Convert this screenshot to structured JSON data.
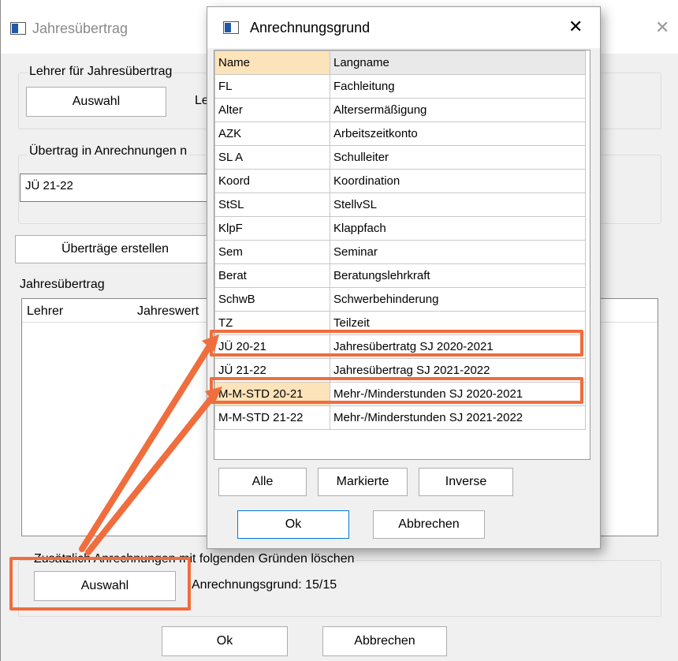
{
  "main": {
    "title": "Jahresübertrag",
    "teacher_group_label": "Lehrer für Jahresübertrag",
    "select_button": "Auswahl",
    "teacher_text": "Le",
    "transfer_group_label": "Übertrag in Anrechnungen n",
    "transfer_value": "JÜ 21-22",
    "create_button": "Überträge erstellen",
    "list_label": "Jahresübertrag",
    "list_columns": [
      "Lehrer",
      "Jahreswert"
    ],
    "delete_group_label": "Zusätzlich Anrechnungen mit folgenden Gründen löschen",
    "delete_select_button": "Auswahl",
    "reason_count": "Anrechnungsgrund: 15/15",
    "ok_button": "Ok",
    "cancel_button": "Abbrechen"
  },
  "dialog": {
    "title": "Anrechnungsgrund",
    "columns": [
      "Name",
      "Langname"
    ],
    "rows": [
      {
        "name": "FL",
        "long": "Fachleitung"
      },
      {
        "name": "Alter",
        "long": "Altersermäßigung"
      },
      {
        "name": "AZK",
        "long": "Arbeitszeitkonto"
      },
      {
        "name": "SL A",
        "long": "Schulleiter"
      },
      {
        "name": "Koord",
        "long": "Koordination"
      },
      {
        "name": "StSL",
        "long": "StellvSL"
      },
      {
        "name": "KlpF",
        "long": "Klappfach"
      },
      {
        "name": "Sem",
        "long": "Seminar"
      },
      {
        "name": "Berat",
        "long": "Beratungslehrkraft"
      },
      {
        "name": "SchwB",
        "long": "Schwerbehinderung"
      },
      {
        "name": "TZ",
        "long": "Teilzeit"
      },
      {
        "name": "JÜ 20-21",
        "long": "Jahresübertratg SJ 2020-2021"
      },
      {
        "name": "JÜ 21-22",
        "long": "Jahresübertrag SJ 2021-2022"
      },
      {
        "name": "M-M-STD 20-21",
        "long": "Mehr-/Minderstunden SJ 2020-2021"
      },
      {
        "name": "M-M-STD 21-22",
        "long": "Mehr-/Minderstunden SJ 2021-2022"
      }
    ],
    "buttons": {
      "all": "Alle",
      "marked": "Markierte",
      "inverse": "Inverse",
      "ok": "Ok",
      "cancel": "Abbrechen"
    },
    "close_glyph": "✕"
  },
  "annotation_color": "#f06d3d"
}
